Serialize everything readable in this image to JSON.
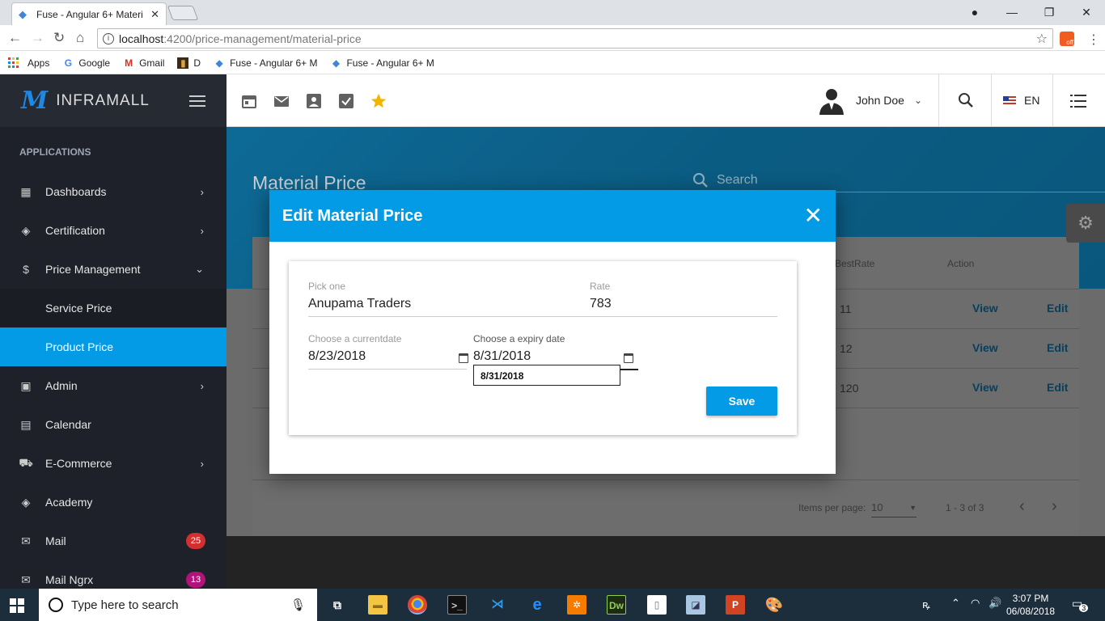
{
  "browser": {
    "tab_title": "Fuse - Angular 6+ Materi",
    "tab_close": "✕",
    "url_host": "localhost",
    "url_path": ":4200/price-management/material-price",
    "bookmarks": [
      {
        "label": "Apps"
      },
      {
        "label": "Google"
      },
      {
        "label": "Gmail"
      },
      {
        "label": "D"
      },
      {
        "label": "Fuse - Angular 6+ M"
      },
      {
        "label": "Fuse - Angular 6+ M"
      }
    ],
    "ext_label": "off"
  },
  "sidebar": {
    "brand": "INFRAMALL",
    "group_title": "APPLICATIONS",
    "items": [
      {
        "label": "Dashboards"
      },
      {
        "label": "Certification"
      },
      {
        "label": "Price Management"
      },
      {
        "label": "Service Price"
      },
      {
        "label": "Product Price"
      },
      {
        "label": "Admin"
      },
      {
        "label": "Calendar"
      },
      {
        "label": "E-Commerce"
      },
      {
        "label": "Academy"
      },
      {
        "label": "Mail",
        "badge": "25",
        "badge_color": "#d32f2f"
      },
      {
        "label": "Mail Ngrx",
        "badge": "13",
        "badge_color": "#b0137a"
      }
    ]
  },
  "toolbar": {
    "user_name": "John Doe",
    "language": "EN"
  },
  "page": {
    "title": "Material Price",
    "search_placeholder": "Search",
    "columns": {
      "best_rate": "BestRate",
      "action": "Action"
    },
    "rows": [
      {
        "best_rate": "11",
        "view": "View",
        "edit": "Edit"
      },
      {
        "best_rate": "12",
        "view": "View",
        "edit": "Edit"
      },
      {
        "best_rate": "120",
        "view": "View",
        "edit": "Edit"
      }
    ],
    "paginator": {
      "items_per_page_label": "Items per page:",
      "page_size": "10",
      "range": "1 - 3 of 3"
    }
  },
  "dialog": {
    "title": "Edit Material Price",
    "pick_label": "Pick one",
    "pick_value": "Anupama Traders",
    "rate_label": "Rate",
    "rate_value": "783",
    "current_date_label": "Choose a currentdate",
    "current_date_value": "8/23/2018",
    "expiry_date_label": "Choose a expiry date",
    "expiry_date_value": "8/31/2018",
    "tooltip": "8/31/2018",
    "save_label": "Save"
  },
  "taskbar": {
    "search_placeholder": "Type here to search",
    "time": "3:07 PM",
    "date": "06/08/2018",
    "notification_count": "3"
  },
  "colors": {
    "primary": "#039be5",
    "sidebar_bg": "#1e2129"
  }
}
